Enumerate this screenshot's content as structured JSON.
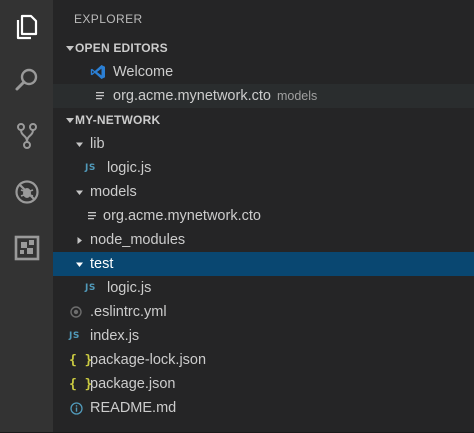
{
  "explorer": {
    "title": "EXPLORER"
  },
  "open_editors": {
    "header": "OPEN EDITORS",
    "items": [
      {
        "label": "Welcome",
        "desc": ""
      },
      {
        "label": "org.acme.mynetwork.cto",
        "desc": "models"
      }
    ]
  },
  "workspace": {
    "header": "MY-NETWORK",
    "tree": {
      "lib": "lib",
      "lib_logic": "logic.js",
      "models": "models",
      "models_cto": "org.acme.mynetwork.cto",
      "node_modules": "node_modules",
      "test": "test",
      "test_logic": "logic.js",
      "eslintrc": ".eslintrc.yml",
      "index": "index.js",
      "package_lock": "package-lock.json",
      "package": "package.json",
      "readme": "README.md"
    }
  },
  "badges": {
    "js": "JS",
    "json": "{ }"
  },
  "colors": {
    "activity_bar": "#333333",
    "side_bar": "#252526",
    "selection": "#094771",
    "js_icon": "#519aba",
    "json_icon": "#cbcb41",
    "vscode_blue": "#2b7fd4"
  }
}
